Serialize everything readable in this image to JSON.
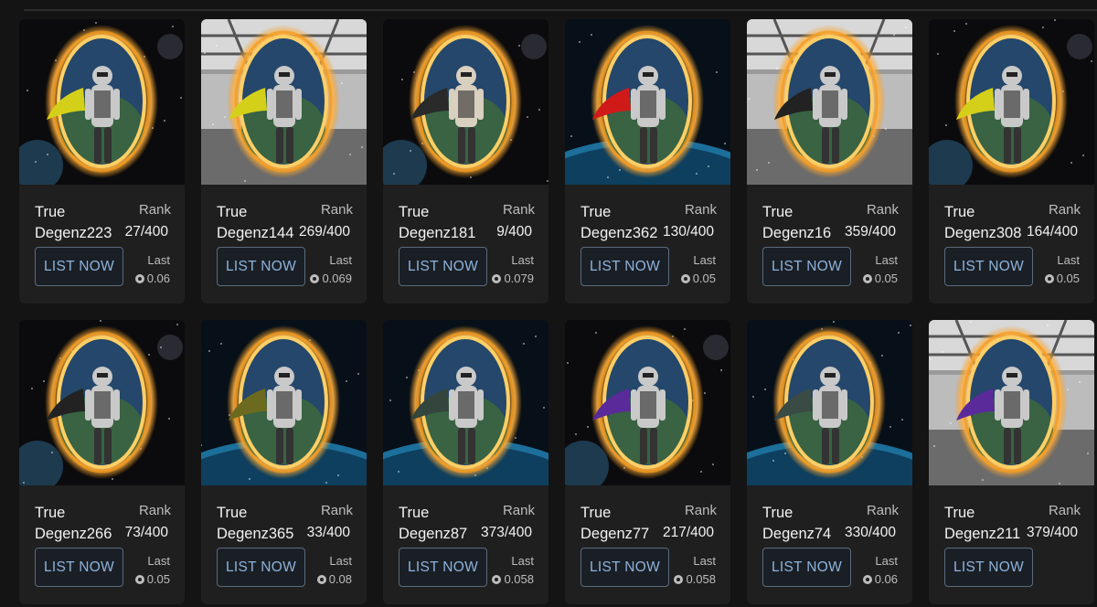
{
  "collection_items": [
    {
      "name": "True\nDegenz223",
      "rank_label": "Rank",
      "rank": "27/400",
      "button_label": "LIST NOW",
      "last_label": "Last",
      "last_price": "0.06",
      "bg": "space",
      "cape": "#d4d01a",
      "skin": "#c9c9c9"
    },
    {
      "name": "True\nDegenz144",
      "rank_label": "Rank",
      "rank": "269/400",
      "button_label": "LIST NOW",
      "last_label": "Last",
      "last_price": "0.069",
      "bg": "hangar",
      "cape": "#d4d01a",
      "skin": "#c9c9c9"
    },
    {
      "name": "True\nDegenz181",
      "rank_label": "Rank",
      "rank": "9/400",
      "button_label": "LIST NOW",
      "last_label": "Last",
      "last_price": "0.079",
      "bg": "space",
      "cape": "#2a2a2a",
      "skin": "#d9d0c0"
    },
    {
      "name": "True\nDegenz362",
      "rank_label": "Rank",
      "rank": "130/400",
      "button_label": "LIST NOW",
      "last_label": "Last",
      "last_price": "0.05",
      "bg": "planet",
      "cape": "#d01a1a",
      "skin": "#c9c9c9"
    },
    {
      "name": "True\nDegenz16",
      "rank_label": "Rank",
      "rank": "359/400",
      "button_label": "LIST NOW",
      "last_label": "Last",
      "last_price": "0.05",
      "bg": "hangar",
      "cape": "#222222",
      "skin": "#c9c9c9"
    },
    {
      "name": "True\nDegenz308",
      "rank_label": "Rank",
      "rank": "164/400",
      "button_label": "LIST NOW",
      "last_label": "Last",
      "last_price": "0.05",
      "bg": "space",
      "cape": "#d4d01a",
      "skin": "#c9c9c9"
    },
    {
      "name": "True\nDegenz266",
      "rank_label": "Rank",
      "rank": "73/400",
      "button_label": "LIST NOW",
      "last_label": "Last",
      "last_price": "0.05",
      "bg": "space",
      "cape": "#222222",
      "skin": "#c9c9c9"
    },
    {
      "name": "True\nDegenz365",
      "rank_label": "Rank",
      "rank": "33/400",
      "button_label": "LIST NOW",
      "last_label": "Last",
      "last_price": "0.08",
      "bg": "planet",
      "cape": "#6b6a1e",
      "skin": "#c9c9c9"
    },
    {
      "name": "True\nDegenz87",
      "rank_label": "Rank",
      "rank": "373/400",
      "button_label": "LIST NOW",
      "last_label": "Last",
      "last_price": "0.058",
      "bg": "planet",
      "cape": "#34453e",
      "skin": "#c9c9c9"
    },
    {
      "name": "True\nDegenz77",
      "rank_label": "Rank",
      "rank": "217/400",
      "button_label": "LIST NOW",
      "last_label": "Last",
      "last_price": "0.058",
      "bg": "space",
      "cape": "#5a2a9a",
      "skin": "#c9c9c9"
    },
    {
      "name": "True\nDegenz74",
      "rank_label": "Rank",
      "rank": "330/400",
      "button_label": "LIST NOW",
      "last_label": "Last",
      "last_price": "0.06",
      "bg": "planet",
      "cape": "#3a4a44",
      "skin": "#c9c9c9"
    },
    {
      "name": "True\nDegenz211",
      "rank_label": "Rank",
      "rank": "379/400",
      "button_label": "LIST NOW",
      "last_label": "",
      "last_price": "",
      "bg": "hangar",
      "cape": "#5a2a9a",
      "skin": "#c9c9c9"
    }
  ],
  "colors": {
    "page_bg": "#141414",
    "card_bg": "#1f1f1f",
    "button_text": "#8fb3db",
    "button_border": "#5a6a7d",
    "portal_glow": "#f59a1a"
  },
  "icons": {
    "price": "sol-coin-icon"
  }
}
